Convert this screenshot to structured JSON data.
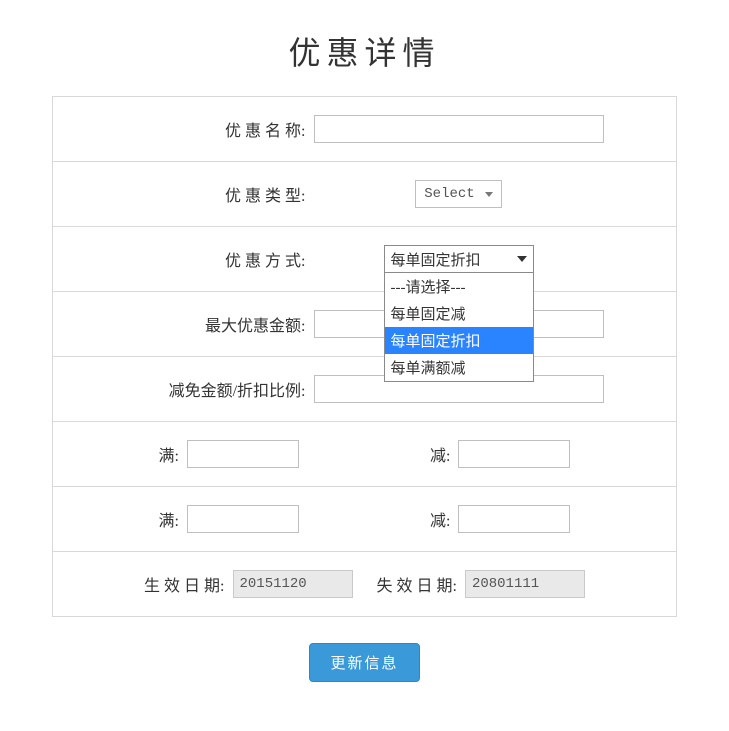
{
  "title": "优惠详情",
  "labels": {
    "name": "优 惠 名 称:",
    "type": "优 惠 类 型:",
    "mode": "优 惠 方 式:",
    "maxAmount": "最大优惠金额:",
    "ratio": "减免金额/折扣比例:",
    "full": "满:",
    "minus": "减:",
    "effDate": "生 效 日 期:",
    "expDate": "失 效 日 期:"
  },
  "typeSelect": {
    "placeholder": "Select"
  },
  "modeSelect": {
    "value": "每单固定折扣",
    "options": [
      {
        "label": "---请选择---",
        "selected": false
      },
      {
        "label": "每单固定减",
        "selected": false
      },
      {
        "label": "每单固定折扣",
        "selected": true
      },
      {
        "label": "每单满额减",
        "selected": false
      }
    ]
  },
  "fields": {
    "name": "",
    "maxAmount": "",
    "ratio": "",
    "full1": "",
    "minus1": "",
    "full2": "",
    "minus2": "",
    "effDate": "20151120",
    "expDate": "20801111"
  },
  "submitLabel": "更新信息"
}
